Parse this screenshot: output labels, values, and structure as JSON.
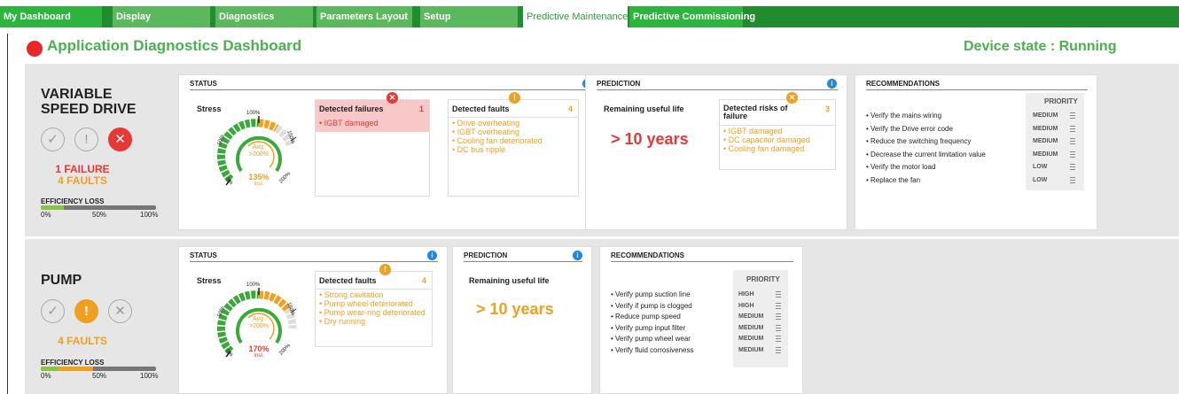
{
  "tabs": [
    {
      "label": "My Dashboard",
      "active": false
    },
    {
      "label": "Display",
      "active": false
    },
    {
      "label": "Diagnostics",
      "active": false
    },
    {
      "label": "Parameters Layout",
      "active": false
    },
    {
      "label": "Setup",
      "active": false
    },
    {
      "label": "Predictive Maintenance",
      "active": true
    },
    {
      "label": "Predictive Commissioning",
      "active": false
    }
  ],
  "header": {
    "title": "Application Diagnostics Dashboard",
    "device_state": "Device state : Running"
  },
  "colors": {
    "green": "#4caf50",
    "red": "#e53935",
    "orange": "#f0a020",
    "tabgreen": "#1f8c2e"
  },
  "drive": {
    "name_line1": "VARIABLE",
    "name_line2": "SPEED DRIVE",
    "failures": "1 FAILURE",
    "faults": "4 FAULTS",
    "eff_label": "EFFICIENCY LOSS",
    "eff_ticks": [
      "0%",
      "50%",
      "100%"
    ],
    "eff_green_fraction": 0.2,
    "eff_orange_fraction": 0,
    "status": {
      "title": "STATUS",
      "stress": "Stress",
      "gauge_value": "135%",
      "gauge_inst": "Inst.",
      "gauge_avg1": "Avg.",
      "gauge_avg2": ">200%",
      "gauge_labels": [
        "0%",
        "50%",
        "100%",
        "150%",
        "200%"
      ],
      "failures_title": "Detected failures",
      "failures_count": "1",
      "failures": [
        "• IGBT damaged"
      ],
      "faults_title": "Detected faults",
      "faults_count": "4",
      "faults": [
        "• Drive overheating",
        "• IGBT overheating",
        "• Cooling fan deteriorated",
        "• DC bus ripple"
      ]
    },
    "prediction": {
      "title": "PREDICTION",
      "rul_label": "Remaining useful life",
      "rul_value": "> 10 years",
      "risks_title1": "Detected risks of",
      "risks_title2": "failure",
      "risks_count": "3",
      "risks": [
        "• IGBT damaged",
        "• DC capacitor damaged",
        "• Cooling fan damaged"
      ]
    },
    "recommendations": {
      "title": "RECOMMENDATIONS",
      "priority_header": "PRIORITY",
      "items": [
        {
          "text": "• Verify the mains wiring",
          "priority": "MEDIUM"
        },
        {
          "text": "• Verify the Drive error code",
          "priority": "MEDIUM"
        },
        {
          "text": "• Reduce the switching frequency",
          "priority": "MEDIUM"
        },
        {
          "text": "• Decrease the current limitation value",
          "priority": "MEDIUM"
        },
        {
          "text": "• Verify the motor load",
          "priority": "LOW"
        },
        {
          "text": "• Replace the fan",
          "priority": "LOW"
        }
      ]
    }
  },
  "pump": {
    "name": "PUMP",
    "faults": "4 FAULTS",
    "eff_label": "EFFICIENCY LOSS",
    "eff_ticks": [
      "0%",
      "50%",
      "100%"
    ],
    "eff_green_fraction": 0.15,
    "eff_orange_fraction": 0.3,
    "status": {
      "title": "STATUS",
      "stress": "Stress",
      "gauge_value": "170%",
      "gauge_inst": "Inst.",
      "gauge_avg1": "Avg.",
      "gauge_avg2": ">200%",
      "gauge_labels": [
        "0%",
        "50%",
        "100%",
        "150%",
        "200%"
      ],
      "faults_title": "Detected faults",
      "faults_count": "4",
      "faults": [
        "• Strong cavitation",
        "• Pump wheel deteriorated",
        "• Pump wear-ring deteriorated",
        "• Dry running"
      ]
    },
    "prediction": {
      "title": "PREDICTION",
      "rul_label": "Remaining useful life",
      "rul_value": "> 10 years"
    },
    "recommendations": {
      "title": "RECOMMENDATIONS",
      "priority_header": "PRIORITY",
      "items": [
        {
          "text": "• Verify pump suction line",
          "priority": "HIGH"
        },
        {
          "text": "• Verify if pump is clogged",
          "priority": "HIGH"
        },
        {
          "text": "• Reduce pump speed",
          "priority": "MEDIUM"
        },
        {
          "text": "• Verify pump input filter",
          "priority": "MEDIUM"
        },
        {
          "text": "• Verify pump wheel wear",
          "priority": "MEDIUM"
        },
        {
          "text": "• Verify fluid corrosiveness",
          "priority": "MEDIUM"
        }
      ]
    }
  }
}
